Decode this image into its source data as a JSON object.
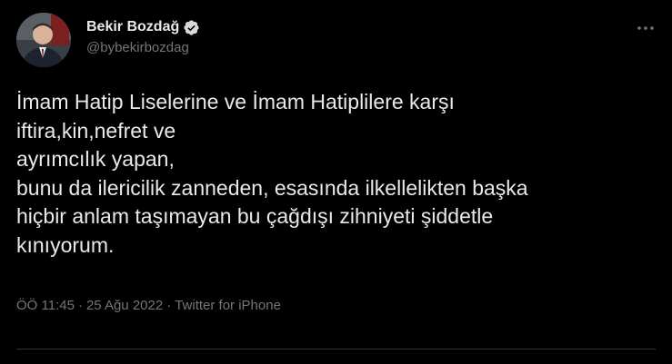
{
  "author": {
    "display_name": "Bekir Bozdağ",
    "handle": "@bybekirbozdag",
    "verified": true
  },
  "tweet": {
    "text": "İmam Hatip Liselerine ve İmam Hatiplilere karşı\niftira,kin,nefret ve\nayrımcılık yapan,\nbunu da ilericilik zanneden, esasında ilkellelikten başka\nhiçbir anlam taşımayan bu çağdışı zihniyeti şiddetle\nkınıyorum."
  },
  "meta": {
    "time": "ÖÖ 11:45",
    "separator": "·",
    "date": "25 Ağu 2022",
    "separator2": "·",
    "source": "Twitter for iPhone"
  },
  "icons": {
    "verified": "verified-badge-icon",
    "more": "more-horizontal-icon"
  },
  "colors": {
    "background": "#000000",
    "text": "#e7e9ea",
    "secondary": "#71767b",
    "divider": "#2f3336"
  }
}
